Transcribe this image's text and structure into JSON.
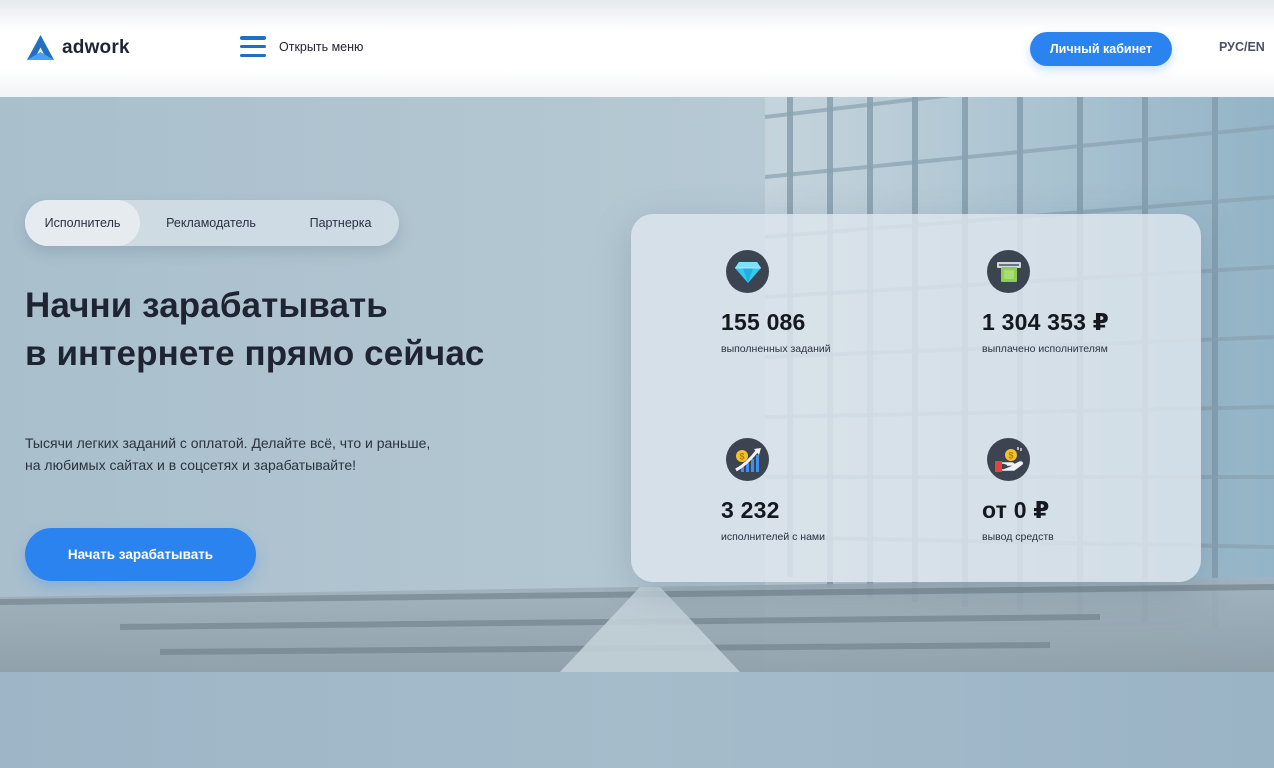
{
  "header": {
    "logo_text": "adwork",
    "menu_label": "Открыть меню",
    "account_button": "Личный кабинет",
    "language": "РУС/EN"
  },
  "tabs": [
    {
      "label": "Исполнитель",
      "active": true
    },
    {
      "label": "Рекламодатель",
      "active": false
    },
    {
      "label": "Партнерка",
      "active": false
    }
  ],
  "hero": {
    "headline_line1": "Начни зарабатывать",
    "headline_line2": "в интернете прямо сейчас",
    "subtitle_line1": "Тысячи легких заданий с оплатой. Делайте всё, что и раньше,",
    "subtitle_line2": "на любимых сайтах и в соцсетях и зарабатывайте!",
    "cta_label": "Начать зарабатывать"
  },
  "stats": [
    {
      "icon": "diamond-icon",
      "value": "155 086",
      "caption": "выполненных заданий"
    },
    {
      "icon": "atm-cash-icon",
      "value": "1 304 353 ₽",
      "caption": "выплачено исполнителям"
    },
    {
      "icon": "growth-chart-icon",
      "value": "3 232",
      "caption": "исполнителей с нами"
    },
    {
      "icon": "withdraw-hand-icon",
      "value": "от 0 ₽",
      "caption": "вывод средств"
    }
  ],
  "colors": {
    "accent": "#2b83f0",
    "text_dark": "#1f2433",
    "logo_blue": "#1f6fc5",
    "icon_bg": "#3c4452"
  }
}
